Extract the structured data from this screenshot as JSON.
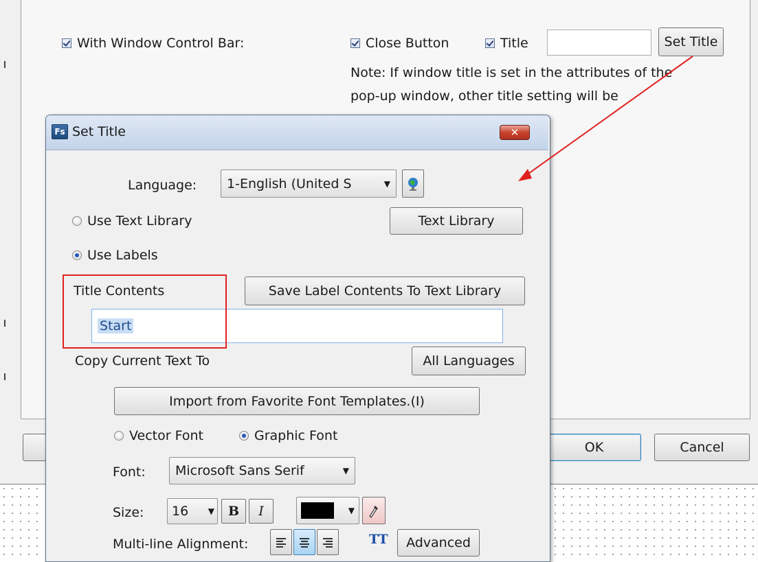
{
  "outer": {
    "with_control_bar_label": "With Window Control Bar:",
    "close_button_label": "Close Button",
    "title_label": "Title",
    "title_value": "",
    "set_title_button": "Set Title",
    "note_line1": "Note: If window title is set in the attributes of the",
    "note_line2": "pop-up window, other title setting will be",
    "ok_button": "OK",
    "cancel_button": "Cancel"
  },
  "dialog": {
    "title": "Set Title",
    "app_icon_text": "Fs",
    "close_glyph": "✕",
    "language_label": "Language:",
    "language_value": "1-English (United S",
    "use_text_library_label": "Use Text Library",
    "text_library_button": "Text Library",
    "use_labels_label": "Use Labels",
    "title_contents_label": "Title Contents",
    "save_label_button": "Save Label Contents To Text Library",
    "title_contents_value": "Start",
    "copy_current_text_label": "Copy Current Text To",
    "all_languages_button": "All Languages",
    "import_button": "Import from Favorite Font Templates.(I)",
    "vector_font_label": "Vector Font",
    "graphic_font_label": "Graphic Font",
    "font_label": "Font:",
    "font_value": "Microsoft Sans Serif",
    "size_label": "Size:",
    "size_value": "16",
    "bold_glyph": "B",
    "italic_glyph": "I",
    "multiline_label": "Multi-line Alignment:",
    "tt_glyph": "TT",
    "advanced_button": "Advanced"
  },
  "colors": {
    "annotation_red": "#e02020",
    "text_color_swatch": "#000000"
  },
  "icons": [
    "globe-icon",
    "dropdown-arrow-icon",
    "eyedropper-icon",
    "align-left-icon",
    "align-center-icon",
    "align-right-icon",
    "text-style-icon",
    "close-icon"
  ]
}
